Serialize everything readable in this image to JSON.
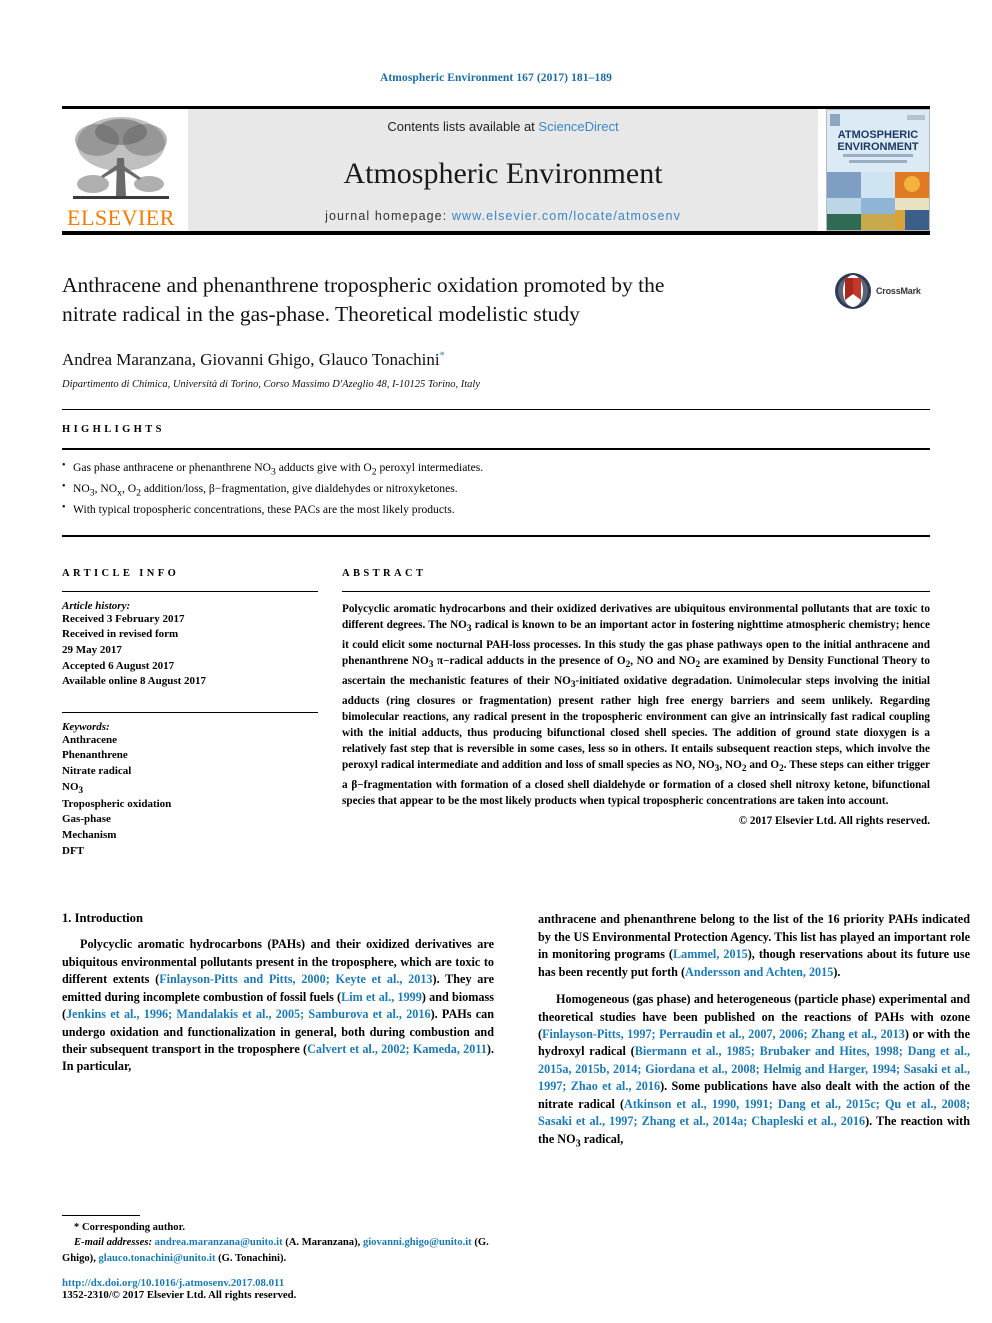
{
  "running_head": "Atmospheric Environment 167 (2017) 181–189",
  "masthead": {
    "publisher_logo_label": "ELSEVIER",
    "contents_prefix": "Contents lists available at ",
    "contents_link": "ScienceDirect",
    "journal_name": "Atmospheric Environment",
    "homepage_prefix": "journal homepage: ",
    "homepage_url": "www.elsevier.com/locate/atmosenv",
    "cover_title_line1": "ATMOSPHERIC",
    "cover_title_line2": "ENVIRONMENT"
  },
  "article": {
    "title": "Anthracene and phenanthrene tropospheric oxidation promoted by the nitrate radical in the gas-phase. Theoretical modelistic study",
    "authors": "Andrea Maranzana, Giovanni Ghigo, Glauco Tonachini",
    "corresponding_marker": "*",
    "affiliation": "Dipartimento di Chimica, Università di Torino, Corso Massimo D'Azeglio 48, I-10125 Torino, Italy",
    "crossmark_label": "CrossMark"
  },
  "highlights": {
    "label": "HIGHLIGHTS",
    "items": [
      "Gas phase anthracene or phenanthrene NO3 adducts give with O2 peroxyl intermediates.",
      "NO3, NOx, O2 addition/loss, β−fragmentation, give dialdehydes or nitroxyketones.",
      "With typical tropospheric concentrations, these PACs are the most likely products."
    ]
  },
  "article_info": {
    "label": "ARTICLE INFO",
    "history_heading": "Article history:",
    "history_lines": [
      "Received 3 February 2017",
      "Received in revised form",
      "29 May 2017",
      "Accepted 6 August 2017",
      "Available online 8 August 2017"
    ],
    "keywords_heading": "Keywords:",
    "keywords": [
      "Anthracene",
      "Phenanthrene",
      "Nitrate radical",
      "NO3",
      "Tropospheric oxidation",
      "Gas-phase",
      "Mechanism",
      "DFT"
    ]
  },
  "abstract": {
    "label": "ABSTRACT",
    "text": "Polycyclic aromatic hydrocarbons and their oxidized derivatives are ubiquitous environmental pollutants that are toxic to different degrees. The NO3 radical is known to be an important actor in fostering nighttime atmospheric chemistry; hence it could elicit some nocturnal PAH-loss processes. In this study the gas phase pathways open to the initial anthracene and phenanthrene NO3 π−radical adducts in the presence of O2, NO and NO2 are examined by Density Functional Theory to ascertain the mechanistic features of their NO3-initiated oxidative degradation. Unimolecular steps involving the initial adducts (ring closures or fragmentation) present rather high free energy barriers and seem unlikely. Regarding bimolecular reactions, any radical present in the tropospheric environment can give an intrinsically fast radical coupling with the initial adducts, thus producing bifunctional closed shell species. The addition of ground state dioxygen is a relatively fast step that is reversible in some cases, less so in others. It entails subsequent reaction steps, which involve the peroxyl radical intermediate and addition and loss of small species as NO, NO3, NO2 and O2. These steps can either trigger a β−fragmentation with formation of a closed shell dialdehyde or formation of a closed shell nitroxy ketone, bifunctional species that appear to be the most likely products when typical tropospheric concentrations are taken into account.",
    "copyright": "© 2017 Elsevier Ltd. All rights reserved."
  },
  "introduction": {
    "heading": "1. Introduction",
    "left_paragraph_parts": [
      {
        "t": "Polycyclic aromatic hydrocarbons (PAHs) and their oxidized derivatives are ubiquitous environmental pollutants present in the troposphere, which are toxic to different extents (",
        "link": false
      },
      {
        "t": "Finlayson-Pitts and Pitts, 2000; Keyte et al., 2013",
        "link": true
      },
      {
        "t": "). They are emitted during incomplete combustion of fossil fuels (",
        "link": false
      },
      {
        "t": "Lim et al., 1999",
        "link": true
      },
      {
        "t": ") and biomass (",
        "link": false
      },
      {
        "t": "Jenkins et al., 1996; Mandalakis et al., 2005; Samburova et al., 2016",
        "link": true
      },
      {
        "t": "). PAHs can undergo oxidation and functionalization in general, both during combustion and their subsequent transport in the troposphere (",
        "link": false
      },
      {
        "t": "Calvert et al., 2002; Kameda, 2011",
        "link": true
      },
      {
        "t": "). In particular,",
        "link": false
      }
    ],
    "right_paragraph1_parts": [
      {
        "t": "anthracene and phenanthrene belong to the list of the 16 priority PAHs indicated by the US Environmental Protection Agency. This list has played an important role in monitoring programs (",
        "link": false
      },
      {
        "t": "Lammel, 2015",
        "link": true
      },
      {
        "t": "), though reservations about its future use has been recently put forth (",
        "link": false
      },
      {
        "t": "Andersson and Achten, 2015",
        "link": true
      },
      {
        "t": ").",
        "link": false
      }
    ],
    "right_paragraph2_parts": [
      {
        "t": "Homogeneous (gas phase) and heterogeneous (particle phase) experimental and theoretical studies have been published on the reactions of PAHs with ozone (",
        "link": false
      },
      {
        "t": "Finlayson-Pitts, 1997; Perraudin et al., 2007, 2006; Zhang et al., 2013",
        "link": true
      },
      {
        "t": ") or with the hydroxyl radical (",
        "link": false
      },
      {
        "t": "Biermann et al., 1985; Brubaker and Hites, 1998; Dang et al., 2015a, 2015b, 2014; Giordana et al., 2008; Helmig and Harger, 1994; Sasaki et al., 1997; Zhao et al., 2016",
        "link": true
      },
      {
        "t": "). Some publications have also dealt with the action of the nitrate radical (",
        "link": false
      },
      {
        "t": "Atkinson et al., 1990, 1991; Dang et al., 2015c; Qu et al., 2008; Sasaki et al., 1997; Zhang et al., 2014a; Chapleski et al., 2016",
        "link": true
      },
      {
        "t": "). The reaction with the NO3 radical,",
        "link": false
      }
    ]
  },
  "footnote": {
    "corresponding_author": "* Corresponding author.",
    "email_label": "E-mail addresses:",
    "emails_parts": [
      {
        "t": "andrea.maranzana@unito.it",
        "link": true
      },
      {
        "t": " (A. Maranzana), ",
        "link": false
      },
      {
        "t": "giovanni.ghigo@unito.it",
        "link": true
      },
      {
        "t": " (G. Ghigo), ",
        "link": false
      },
      {
        "t": "glauco.tonachini@unito.it",
        "link": true
      },
      {
        "t": " (G. Tonachini).",
        "link": false
      }
    ],
    "doi": "http://dx.doi.org/10.1016/j.atmosenv.2017.08.011",
    "issn_line": "1352-2310/© 2017 Elsevier Ltd. All rights reserved."
  },
  "colors": {
    "link_blue": "#1c7ab5",
    "header_blue": "#1c6ba3",
    "elsevier_orange": "#f07c00",
    "masthead_grey": "#e8e8e8"
  }
}
